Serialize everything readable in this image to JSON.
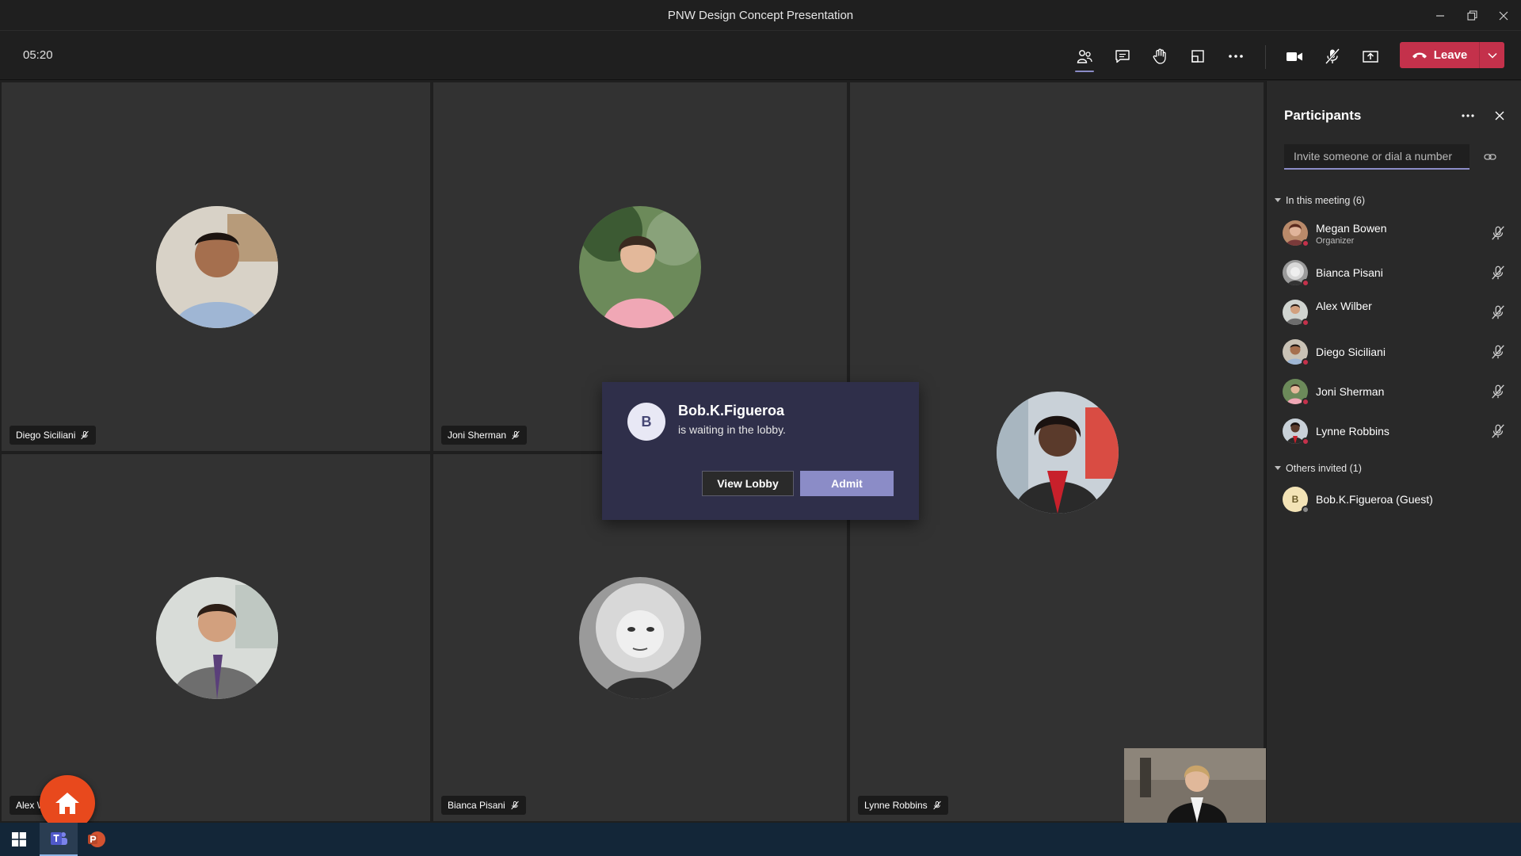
{
  "window": {
    "title": "PNW Design Concept Presentation"
  },
  "toolbar": {
    "timer": "05:20",
    "leave_label": "Leave"
  },
  "tiles": [
    {
      "name": "Diego Siciliani"
    },
    {
      "name": "Joni Sherman"
    },
    {
      "name": "Alex Wilber"
    },
    {
      "name": "Bianca Pisani"
    },
    {
      "name": "Lynne Robbins"
    }
  ],
  "lobby": {
    "initial": "B",
    "name": "Bob.K.Figueroa",
    "message": "is waiting in the lobby.",
    "view_label": "View Lobby",
    "admit_label": "Admit"
  },
  "panel": {
    "title": "Participants",
    "invite_placeholder": "Invite someone or dial a number",
    "in_meeting_label": "In this meeting (6)",
    "participants": [
      {
        "name": "Megan Bowen",
        "role": "Organizer"
      },
      {
        "name": "Bianca Pisani"
      },
      {
        "name": "Alex Wilber"
      },
      {
        "name": "Diego Siciliani"
      },
      {
        "name": "Joni Sherman"
      },
      {
        "name": "Lynne Robbins"
      }
    ],
    "others_label": "Others invited (1)",
    "invited": [
      {
        "initial": "B",
        "name": "Bob.K.Figueroa (Guest)"
      }
    ]
  },
  "colors": {
    "accent": "#8b8cc7",
    "leave": "#c4314b",
    "home": "#e8491d"
  },
  "icons": [
    "people-icon",
    "chat-icon",
    "raise-hand-icon",
    "layout-icon",
    "more-icon",
    "camera-icon",
    "mic-off-icon",
    "share-icon",
    "phone-icon"
  ]
}
